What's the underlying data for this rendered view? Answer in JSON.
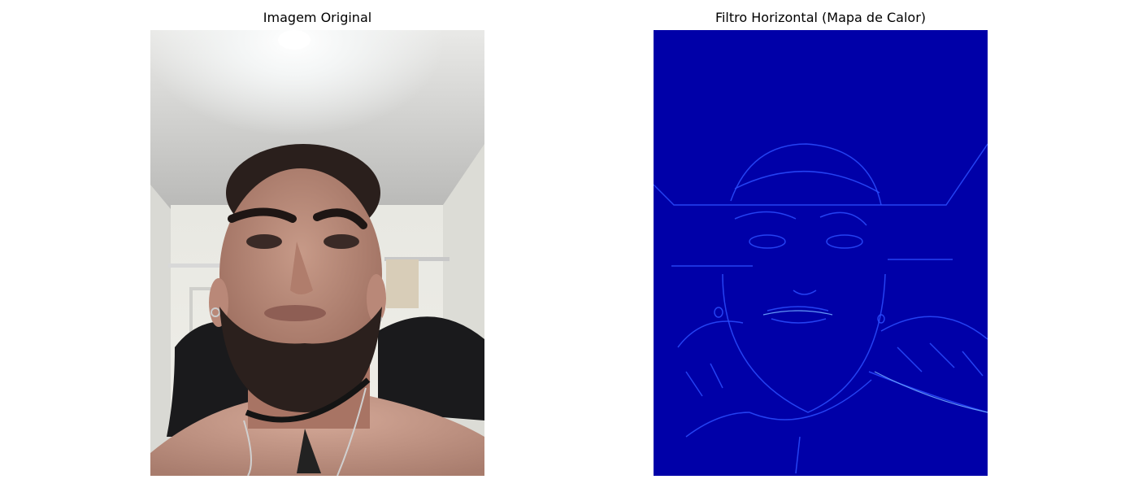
{
  "figure": {
    "panels": [
      {
        "title": "Imagem Original"
      },
      {
        "title": "Filtro Horizontal (Mapa de Calor)"
      }
    ]
  }
}
